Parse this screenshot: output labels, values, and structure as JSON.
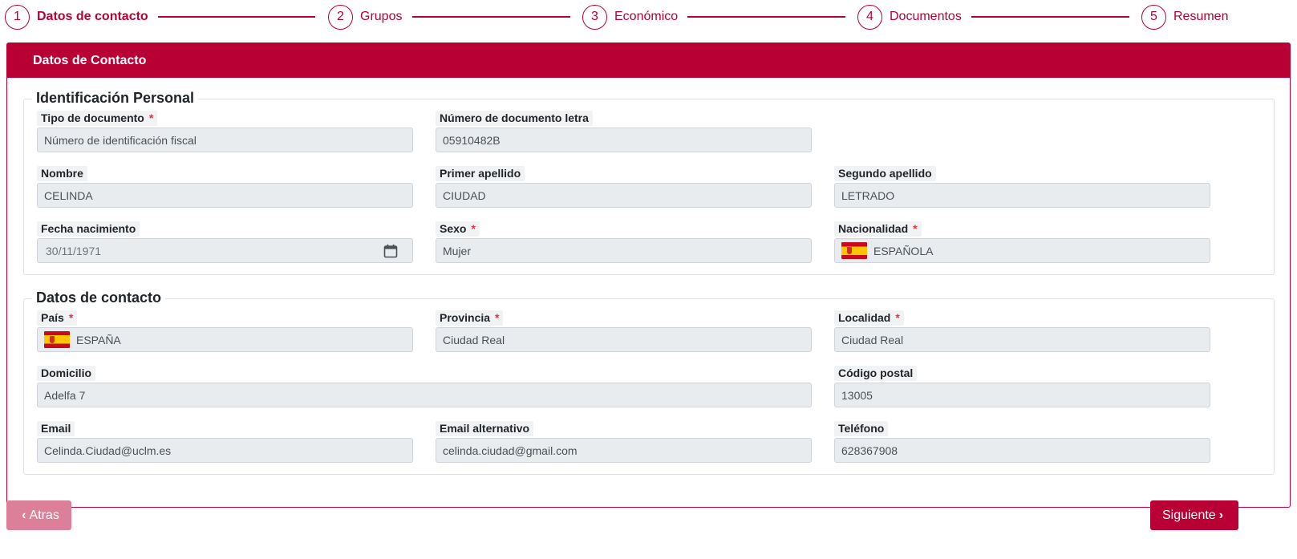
{
  "stepper": {
    "steps": [
      {
        "number": "1",
        "label": "Datos de contacto",
        "active": true
      },
      {
        "number": "2",
        "label": "Grupos",
        "active": false
      },
      {
        "number": "3",
        "label": "Económico",
        "active": false
      },
      {
        "number": "4",
        "label": "Documentos",
        "active": false
      },
      {
        "number": "5",
        "label": "Resumen",
        "active": false
      }
    ]
  },
  "card": {
    "title": "Datos de Contacto",
    "personal": {
      "title": "Identificación Personal",
      "tipo_documento": {
        "label": "Tipo de documento",
        "required": "*",
        "value": "Número de identificación fiscal"
      },
      "numero_documento": {
        "label": "Número de documento letra",
        "value": "05910482B"
      },
      "nombre": {
        "label": "Nombre",
        "value": "CELINDA"
      },
      "primer_apellido": {
        "label": "Primer apellido",
        "value": "CIUDAD"
      },
      "segundo_apellido": {
        "label": "Segundo apellido",
        "value": "LETRADO"
      },
      "fecha_nacimiento": {
        "label": "Fecha nacimiento",
        "value": "30/11/1971",
        "icon": "calendar-icon"
      },
      "sexo": {
        "label": "Sexo",
        "required": "*",
        "value": "Mujer"
      },
      "nacionalidad": {
        "label": "Nacionalidad",
        "required": "*",
        "value": "ESPAÑOLA",
        "icon": "spain-flag-icon"
      }
    },
    "contacto": {
      "title": "Datos de contacto",
      "pais": {
        "label": "País",
        "required": "*",
        "value": "ESPAÑA",
        "icon": "spain-flag-icon"
      },
      "provincia": {
        "label": "Provincia",
        "required": "*",
        "value": "Ciudad Real"
      },
      "localidad": {
        "label": "Localidad",
        "required": "*",
        "value": "Ciudad Real"
      },
      "domicilio": {
        "label": "Domicilio",
        "value": "Adelfa 7"
      },
      "codigo_postal": {
        "label": "Código postal",
        "value": "13005"
      },
      "email": {
        "label": "Email",
        "value": "Celinda.Ciudad@uclm.es"
      },
      "email_alternativo": {
        "label": "Email alternativo",
        "value": "celinda.ciudad@gmail.com"
      },
      "telefono": {
        "label": "Teléfono",
        "value": "628367908"
      }
    }
  },
  "buttons": {
    "back_label": "Atras",
    "next_label": "Siguiente"
  },
  "colors": {
    "brand": "#b80035",
    "back_button": "#dc809a",
    "input_bg": "#e9ecef",
    "required": "#dc3545"
  }
}
